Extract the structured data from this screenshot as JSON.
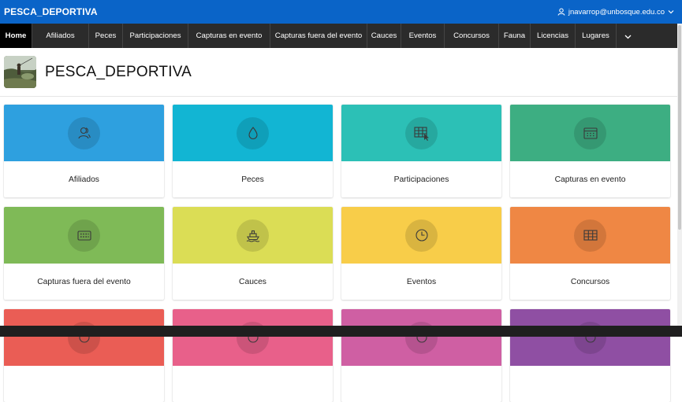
{
  "topbar": {
    "app_title": "PESCA_DEPORTIVA",
    "user_email": "jnavarrop@unbosque.edu.co",
    "color": "#0a64c8"
  },
  "nav": {
    "tabs": [
      {
        "label": "Home",
        "active": true
      },
      {
        "label": "Afiliados",
        "active": false
      },
      {
        "label": "Peces",
        "active": false
      },
      {
        "label": "Participaciones",
        "active": false
      },
      {
        "label": "Capturas en evento",
        "active": false
      },
      {
        "label": "Capturas fuera del evento",
        "active": false
      },
      {
        "label": "Cauces",
        "active": false
      },
      {
        "label": "Eventos",
        "active": false
      },
      {
        "label": "Concursos",
        "active": false
      },
      {
        "label": "Fauna",
        "active": false
      },
      {
        "label": "Licencias",
        "active": false
      },
      {
        "label": "Lugares",
        "active": false
      }
    ],
    "more_icon": "chevron-down-icon"
  },
  "header": {
    "title": "PESCA_DEPORTIVA",
    "logo": "fishing-logo"
  },
  "cards": [
    {
      "label": "Afiliados",
      "color": "#2ea0df",
      "icon": "users-icon"
    },
    {
      "label": "Peces",
      "color": "#12b5d3",
      "icon": "droplet-icon"
    },
    {
      "label": "Participaciones",
      "color": "#2cc0b6",
      "icon": "table-pointer-icon"
    },
    {
      "label": "Capturas en evento",
      "color": "#3dae82",
      "icon": "calendar-icon"
    },
    {
      "label": "Capturas fuera del evento",
      "color": "#7fba57",
      "icon": "keyboard-icon"
    },
    {
      "label": "Cauces",
      "color": "#dbdd55",
      "icon": "ship-icon"
    },
    {
      "label": "Eventos",
      "color": "#f8cd49",
      "icon": "clock-icon"
    },
    {
      "label": "Concursos",
      "color": "#ef8744",
      "icon": "table-icon"
    },
    {
      "label": "",
      "color": "#ea5d55",
      "icon": "generic-icon"
    },
    {
      "label": "",
      "color": "#e8608a",
      "icon": "generic-icon"
    },
    {
      "label": "",
      "color": "#cf5fa3",
      "icon": "generic-icon"
    },
    {
      "label": "",
      "color": "#8f4fa3",
      "icon": "generic-icon"
    }
  ]
}
